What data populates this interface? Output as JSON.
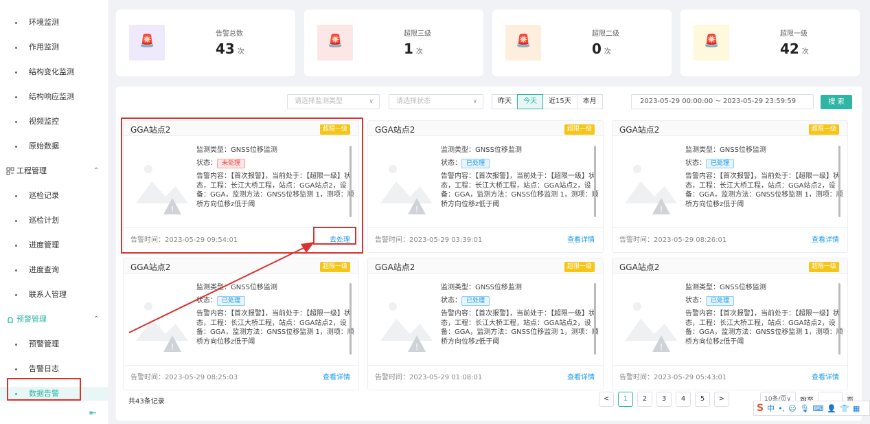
{
  "sidebar": {
    "top_label": "环境监测",
    "items_1": [
      {
        "label": "环境监测"
      },
      {
        "label": "作用监测"
      },
      {
        "label": "结构变化监测"
      },
      {
        "label": "结构响应监测"
      },
      {
        "label": "视频监控"
      },
      {
        "label": "原始数据"
      }
    ],
    "group_engineering": "工程管理",
    "items_2": [
      {
        "label": "巡检记录"
      },
      {
        "label": "巡检计划"
      },
      {
        "label": "进度管理"
      },
      {
        "label": "进度查询"
      },
      {
        "label": "联系人管理"
      }
    ],
    "group_alarm": "预警管理",
    "items_3": [
      {
        "label": "预警管理"
      },
      {
        "label": "告警日志"
      },
      {
        "label": "数据告警"
      }
    ]
  },
  "stats": [
    {
      "caption": "告警总数",
      "value": "43",
      "unit": "次",
      "bg": "#eee9fb",
      "color": "#7b5ce6"
    },
    {
      "caption": "超限三级",
      "value": "1",
      "unit": "次",
      "bg": "#fde6e6",
      "color": "#e53935"
    },
    {
      "caption": "超限二级",
      "value": "0",
      "unit": "次",
      "bg": "#fdeedd",
      "color": "#f0812a"
    },
    {
      "caption": "超限一级",
      "value": "42",
      "unit": "次",
      "bg": "#fef8dc",
      "color": "#f2c200"
    }
  ],
  "filters": {
    "type_placeholder": "请选择监测类型",
    "status_placeholder": "请选择状态",
    "seg": [
      "昨天",
      "今天",
      "近15天",
      "本月"
    ],
    "range": "2023-05-29 00:00:00  ~  2023-05-29 23:59:59",
    "search": "搜 索"
  },
  "cards": [
    {
      "title": "GGA站点2",
      "level": "超限一级",
      "type": "监测类型：GNSS位移监测",
      "status_label": "状态：",
      "status": "未处理",
      "desc": "告警内容：【首次报警】，当前处于：【超限一级】状态，工程：长江大桥工程，站点：GGA站点2，设备：GGA，监测方法：GNSS位移监测 1，测项：顺桥方向位移z低于阈",
      "time": "告警时间：2023-05-29 09:54:01",
      "action": "去处理"
    },
    {
      "title": "GGA站点2",
      "level": "超限一级",
      "type": "监测类型：GNSS位移监测",
      "status_label": "状态：",
      "status": "已处理",
      "desc": "告警内容：【首次报警】，当前处于：【超限一级】状态，工程：长江大桥工程，站点：GGA站点2，设备：GGA，监测方法：GNSS位移监测 1，测项：顺桥方向位移z低于阈",
      "time": "告警时间：2023-05-29 03:39:01",
      "action": "查看详情"
    },
    {
      "title": "GGA站点2",
      "level": "超限一级",
      "type": "监测类型：GNSS位移监测",
      "status_label": "状态：",
      "status": "已处理",
      "desc": "告警内容：【首次报警】，当前处于：【超限一级】状态，工程：长江大桥工程，站点：GGA站点2，设备：GGA，监测方法：GNSS位移监测 1，测项：顺桥方向位移z低于阈",
      "time": "告警时间：2023-05-29 08:26:01",
      "action": "查看详情"
    },
    {
      "title": "GGA站点2",
      "level": "超限一级",
      "type": "监测类型：GNSS位移监测",
      "status_label": "状态：",
      "status": "已处理",
      "desc": "告警内容：【首次报警】，当前处于：【超限一级】状态，工程：长江大桥工程，站点：GGA站点2，设备：GGA，监测方法：GNSS位移监测 1，测项：顺桥方向位移z低于阈",
      "time": "告警时间：2023-05-29 08:25:03",
      "action": "查看详情"
    },
    {
      "title": "GGA站点2",
      "level": "超限一级",
      "type": "监测类型：GNSS位移监测",
      "status_label": "状态：",
      "status": "已处理",
      "desc": "告警内容：【首次报警】，当前处于：【超限一级】状态，工程：长江大桥工程，站点：GGA站点2，设备：GGA，监测方法：GNSS位移监测 1，测项：顺桥方向位移z低于阈",
      "time": "告警时间：2023-05-29 01:08:01",
      "action": "查看详情"
    },
    {
      "title": "GGA站点2",
      "level": "超限一级",
      "type": "监测类型：GNSS位移监测",
      "status_label": "状态：",
      "status": "已处理",
      "desc": "告警内容：【首次报警】，当前处于：【超限一级】状态，工程：长江大桥工程，站点：GGA站点2，设备：GGA，监测方法：GNSS位移监测 1，测项：顺桥方向位移z低于阈",
      "time": "告警时间：2023-05-29 05:43:01",
      "action": "查看详情"
    }
  ],
  "footer": {
    "total": "共43条记录",
    "prev": "<",
    "pages": [
      "1",
      "2",
      "3",
      "4",
      "5"
    ],
    "next": ">",
    "page_size": "10条/页∨",
    "goto": "跳至",
    "page_label": "页"
  },
  "colors": {
    "accent": "#2eb5a3",
    "highlight": "#d9312f",
    "level_badge": "#f5c518"
  }
}
